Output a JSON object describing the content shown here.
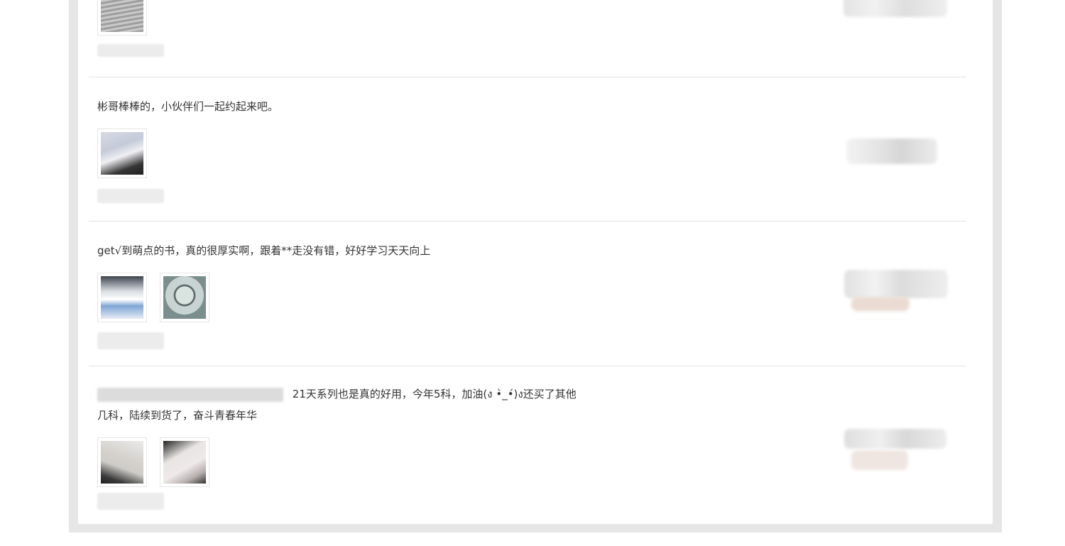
{
  "reviews": [
    {
      "text": "",
      "images": [
        "review-photo"
      ]
    },
    {
      "text": "彬哥棒棒的，小伙伴们一起约起来吧。",
      "images": [
        "review-photo"
      ]
    },
    {
      "text": "get√到萌点的书，真的很厚实啊，跟着**走没有错，好好学习天天向上",
      "images": [
        "review-photo",
        "review-photo"
      ]
    },
    {
      "text_line1": "21天系列也是真的好用，今年5科，加油(ง •̀_•́)ง还买了其他",
      "text_line2": "几科，陆续到货了，奋斗青春年华",
      "images": [
        "review-photo",
        "review-photo"
      ]
    }
  ]
}
